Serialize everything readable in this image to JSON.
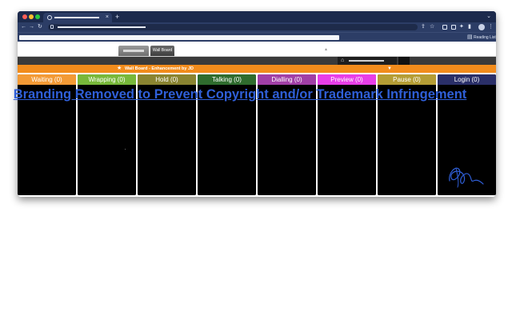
{
  "app": {
    "tab_close_glyph": "×",
    "new_tab_glyph": "+",
    "reading_list_label": "Reading List"
  },
  "board": {
    "tabs": [
      {
        "label": ""
      },
      {
        "label": "Wall Board"
      }
    ],
    "title": "Wall Board - Enhancement by JD",
    "columns": [
      {
        "label": "Waiting (0)",
        "color": "#f39a35"
      },
      {
        "label": "Wrapping (0)",
        "color": "#78b83a"
      },
      {
        "label": "Hold (0)",
        "color": "#8a8431"
      },
      {
        "label": "Talking (0)",
        "color": "#2f6c2e"
      },
      {
        "label": "Dialling (0)",
        "color": "#a13fa6"
      },
      {
        "label": "Preview (0)",
        "color": "#e83ee8"
      },
      {
        "label": "Pause (0)",
        "color": "#b59d35"
      },
      {
        "label": "Login (0)",
        "color": "#2a2f68"
      }
    ]
  },
  "overlay": {
    "text": "Branding Removed to Prevent Copyright and/or Trademark Infringement",
    "color": "#2f5fd8"
  },
  "icons": {
    "home": "home-icon",
    "star": "star-icon",
    "filter": "filter-icon",
    "lock": "lock-icon"
  }
}
